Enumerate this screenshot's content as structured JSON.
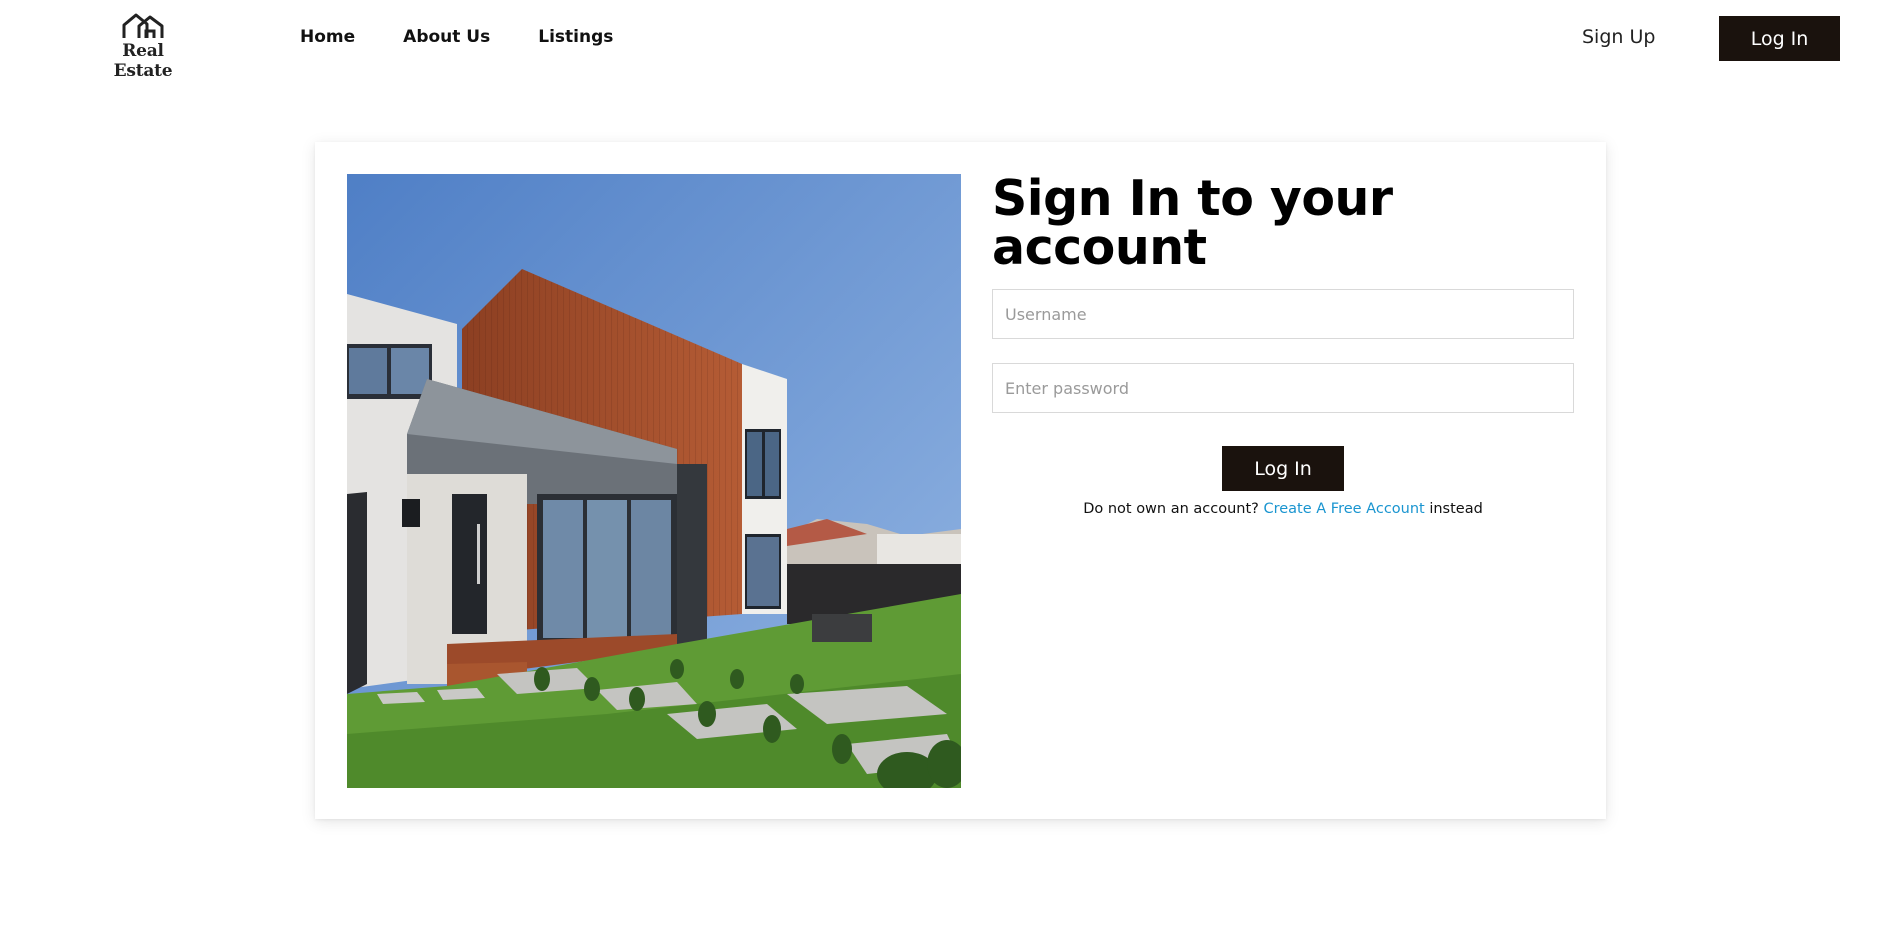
{
  "header": {
    "logo_text": "Real Estate",
    "logo_icon": "house-icon",
    "nav": {
      "home": "Home",
      "about": "About Us",
      "listings": "Listings"
    },
    "signup_label": "Sign Up",
    "login_label": "Log In"
  },
  "login_form": {
    "title": "Sign In to your account",
    "username_placeholder": "Username",
    "username_value": "",
    "password_placeholder": "Enter password",
    "password_value": "",
    "submit_label": "Log In",
    "signup_prompt_before": "Do not own an account? ",
    "signup_link_text": "Create A Free Account",
    "signup_prompt_after": " instead"
  },
  "photo": {
    "subject": "modern house exterior with lawn"
  },
  "colors": {
    "button_bg": "#1a120d",
    "button_text": "#ffffff",
    "link": "#1a95d0",
    "input_border": "#d9d9d9"
  }
}
